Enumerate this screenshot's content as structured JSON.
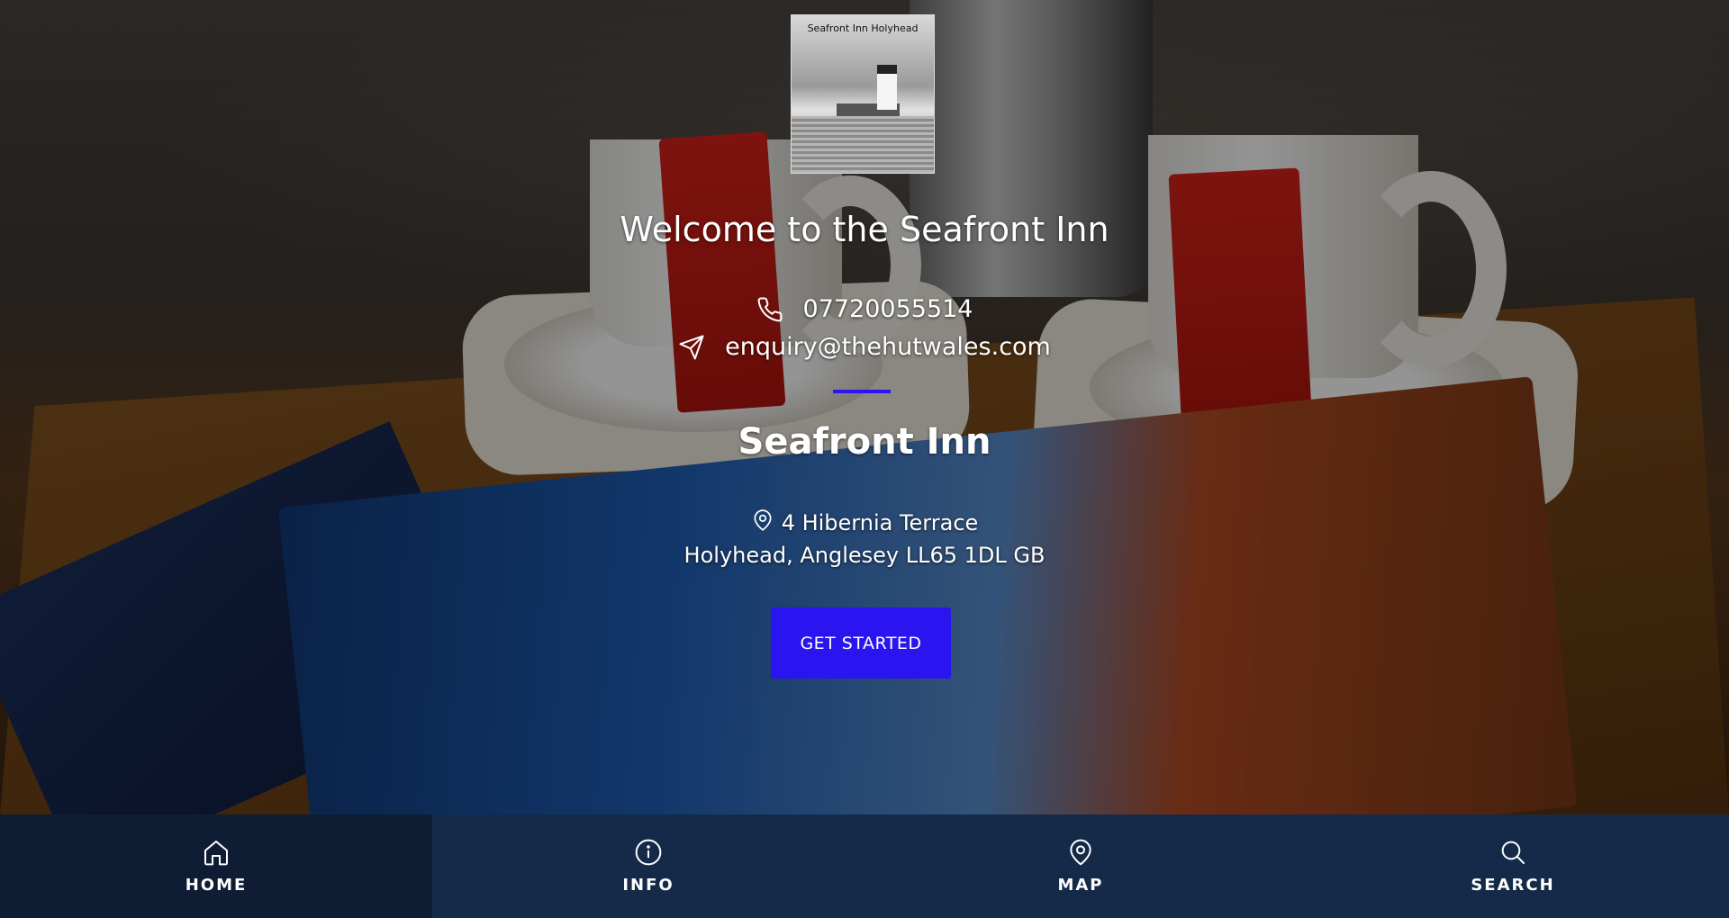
{
  "logo": {
    "text": "Seafront Inn Holyhead"
  },
  "hero": {
    "welcome": "Welcome to the Seafront Inn",
    "phone": "07720055514",
    "email": "enquiry@thehutwales.com",
    "business_name": "Seafront Inn",
    "address_line1": "4 Hibernia Terrace",
    "address_line2": "Holyhead, Anglesey LL65 1DL GB",
    "cta_label": "GET STARTED"
  },
  "nav": {
    "items": [
      {
        "label": "HOME",
        "icon": "home-icon",
        "active": true
      },
      {
        "label": "INFO",
        "icon": "info-icon",
        "active": false
      },
      {
        "label": "MAP",
        "icon": "map-pin-icon",
        "active": false
      },
      {
        "label": "SEARCH",
        "icon": "search-icon",
        "active": false
      }
    ]
  },
  "colors": {
    "accent": "#2a14f0",
    "nav_background": "#142a48",
    "nav_active_background": "#0e1d33",
    "text": "#ffffff"
  }
}
